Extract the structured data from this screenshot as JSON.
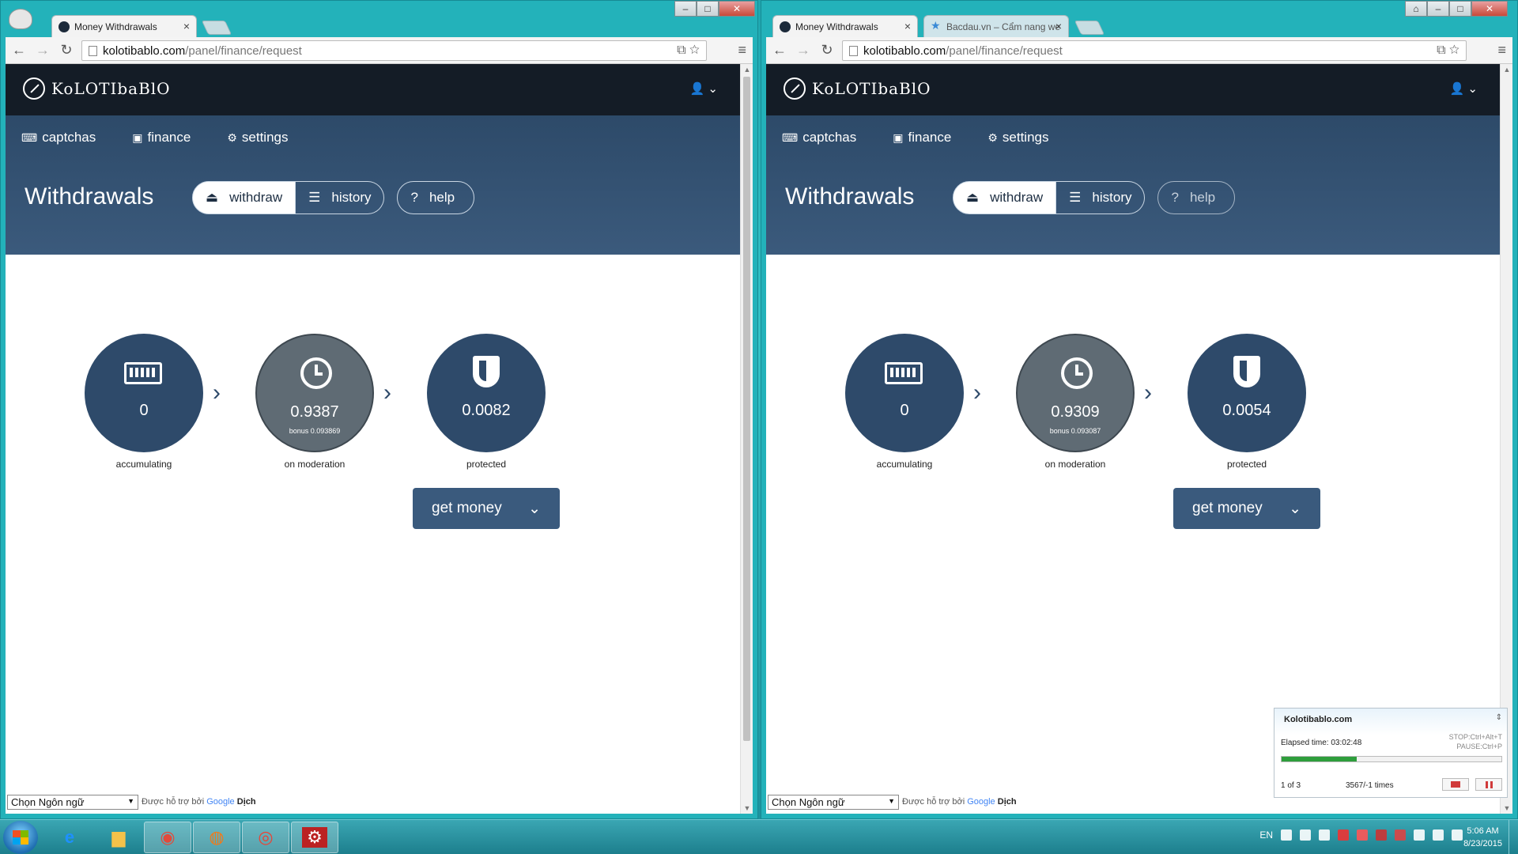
{
  "tabs_left": [
    {
      "title": "Money Withdrawals"
    }
  ],
  "tabs_right": [
    {
      "title": "Money Withdrawals"
    },
    {
      "title": "Bacdau.vn – Cẩm nang we"
    }
  ],
  "url": {
    "host": "kolotibablo.com",
    "path": "/panel/finance/request"
  },
  "site": {
    "logo": "KoLOTIbaBlO",
    "nav": [
      {
        "label": "captchas",
        "icon": "keyboard-icon"
      },
      {
        "label": "finance",
        "icon": "money-icon"
      },
      {
        "label": "settings",
        "icon": "gear-icon"
      }
    ],
    "page_title": "Withdrawals",
    "buttons": {
      "withdraw": "withdraw",
      "history": "history",
      "help": "help"
    },
    "labels": {
      "accumulating": "accumulating",
      "moderation": "on moderation",
      "protected": "protected"
    },
    "get_money": "get money"
  },
  "left": {
    "accumulating": "0",
    "moderation": "0.9387",
    "bonus": "bonus 0.093869",
    "protected": "0.0082"
  },
  "right": {
    "accumulating": "0",
    "moderation": "0.9309",
    "bonus": "bonus 0.093087",
    "protected": "0.0054"
  },
  "footer": {
    "lang_select": "Chọn Ngôn ngữ",
    "powered_prefix": "Được hỗ trợ bởi",
    "google": "Google",
    "translate": "Dịch"
  },
  "macro": {
    "title": "Kolotibablo.com",
    "elapsed": "Elapsed time: 03:02:48",
    "stop_hotkey": "STOP:Ctrl+Alt+T",
    "pause_hotkey": "PAUSE:Ctrl+P",
    "count": "1 of 3",
    "times": "3567/-1 times",
    "progress": 0.34
  },
  "taskbar": {
    "lang": "EN",
    "time": "5:06 AM",
    "date": "8/23/2015"
  },
  "colors": {
    "header": "#141c26",
    "nav_bg": "#2d4a69",
    "circle": "#2e4a6a",
    "circle_gray": "#5f6b74",
    "button": "#3a5a7d",
    "progress": "#2e9e3c"
  }
}
